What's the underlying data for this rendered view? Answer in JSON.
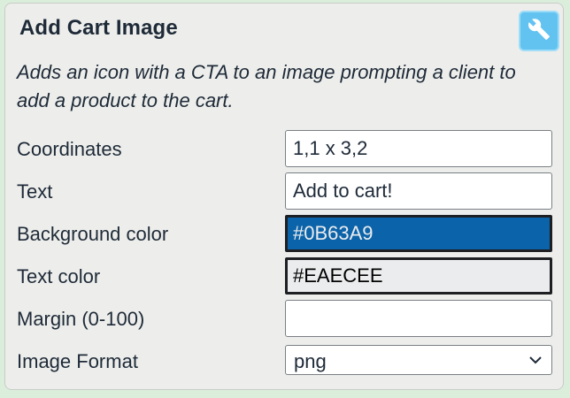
{
  "header": {
    "title": "Add Cart Image",
    "settings_icon": "wrench-icon"
  },
  "description": "Adds an icon with a CTA to an image prompting a client to add a product to the cart.",
  "fields": {
    "coordinates": {
      "label": "Coordinates",
      "value": "1,1 x 3,2"
    },
    "text": {
      "label": "Text",
      "value": "Add to cart!"
    },
    "background_color": {
      "label": "Background color",
      "value": "#0B63A9",
      "text_color": "#EAECEE"
    },
    "text_color": {
      "label": "Text color",
      "value": "#EAECEE",
      "text_color": "#000000"
    },
    "margin": {
      "label": "Margin (0-100)",
      "value": ""
    },
    "image_format": {
      "label": "Image Format",
      "value": "png"
    }
  },
  "colors": {
    "accent": "#62C3F1",
    "panel_bg": "#EDEEEB",
    "page_bg": "#DBEEDB",
    "text": "#1E2A38"
  }
}
